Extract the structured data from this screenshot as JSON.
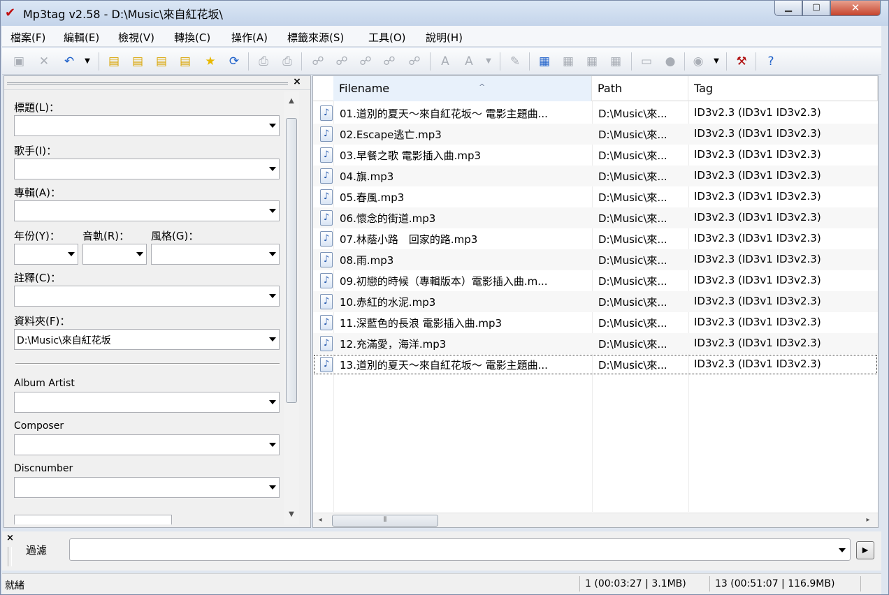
{
  "window": {
    "title": "Mp3tag v2.58  -  D:\\Music\\來自紅花坂\\",
    "app_icon": "checkmark-icon"
  },
  "menu": [
    "檔案(F)",
    "編輯(E)",
    "檢視(V)",
    "轉換(C)",
    "操作(A)",
    "標籤來源(S)",
    "工具(O)",
    "說明(H)"
  ],
  "panel": {
    "title_label": "標題(L)：",
    "artist_label": "歌手(I)：",
    "album_label": "專輯(A)：",
    "year_label": "年份(Y)：",
    "track_label": "音軌(R)：",
    "genre_label": "風格(G)：",
    "comment_label": "註釋(C)：",
    "folder_label": "資料夾(F)：",
    "folder_value": "D:\\Music\\來自紅花坂",
    "album_artist_label": "Album Artist",
    "composer_label": "Composer",
    "discnumber_label": "Discnumber"
  },
  "columns": {
    "filename": "Filename",
    "path": "Path",
    "tag": "Tag"
  },
  "files": [
    {
      "name": "01.道別的夏天～來自紅花坂～ 電影主題曲...",
      "path": "D:\\Music\\來...",
      "tag": "ID3v2.3 (ID3v1 ID3v2.3)"
    },
    {
      "name": "02.Escape逃亡.mp3",
      "path": "D:\\Music\\來...",
      "tag": "ID3v2.3 (ID3v1 ID3v2.3)"
    },
    {
      "name": "03.早餐之歌 電影插入曲.mp3",
      "path": "D:\\Music\\來...",
      "tag": "ID3v2.3 (ID3v1 ID3v2.3)"
    },
    {
      "name": "04.旗.mp3",
      "path": "D:\\Music\\來...",
      "tag": "ID3v2.3 (ID3v1 ID3v2.3)"
    },
    {
      "name": "05.春風.mp3",
      "path": "D:\\Music\\來...",
      "tag": "ID3v2.3 (ID3v1 ID3v2.3)"
    },
    {
      "name": "06.懷念的街道.mp3",
      "path": "D:\\Music\\來...",
      "tag": "ID3v2.3 (ID3v1 ID3v2.3)"
    },
    {
      "name": "07.林蔭小路　回家的路.mp3",
      "path": "D:\\Music\\來...",
      "tag": "ID3v2.3 (ID3v1 ID3v2.3)"
    },
    {
      "name": "08.雨.mp3",
      "path": "D:\\Music\\來...",
      "tag": "ID3v2.3 (ID3v1 ID3v2.3)"
    },
    {
      "name": "09.初戀的時候（專輯版本）電影插入曲.m...",
      "path": "D:\\Music\\來...",
      "tag": "ID3v2.3 (ID3v1 ID3v2.3)"
    },
    {
      "name": "10.赤紅的水泥.mp3",
      "path": "D:\\Music\\來...",
      "tag": "ID3v2.3 (ID3v1 ID3v2.3)"
    },
    {
      "name": "11.深藍色的長浪 電影插入曲.mp3",
      "path": "D:\\Music\\來...",
      "tag": "ID3v2.3 (ID3v1 ID3v2.3)"
    },
    {
      "name": "12.充滿愛，海洋.mp3",
      "path": "D:\\Music\\來...",
      "tag": "ID3v2.3 (ID3v1 ID3v2.3)"
    },
    {
      "name": "13.道別的夏天～來自紅花坂～ 電影主題曲...",
      "path": "D:\\Music\\來...",
      "tag": "ID3v2.3 (ID3v1 ID3v2.3)"
    }
  ],
  "filter": {
    "label": "過濾"
  },
  "status": {
    "ready": "就緒",
    "selected": "1 (00:03:27 | 3.1MB)",
    "total": "13 (00:51:07 | 116.9MB)"
  }
}
